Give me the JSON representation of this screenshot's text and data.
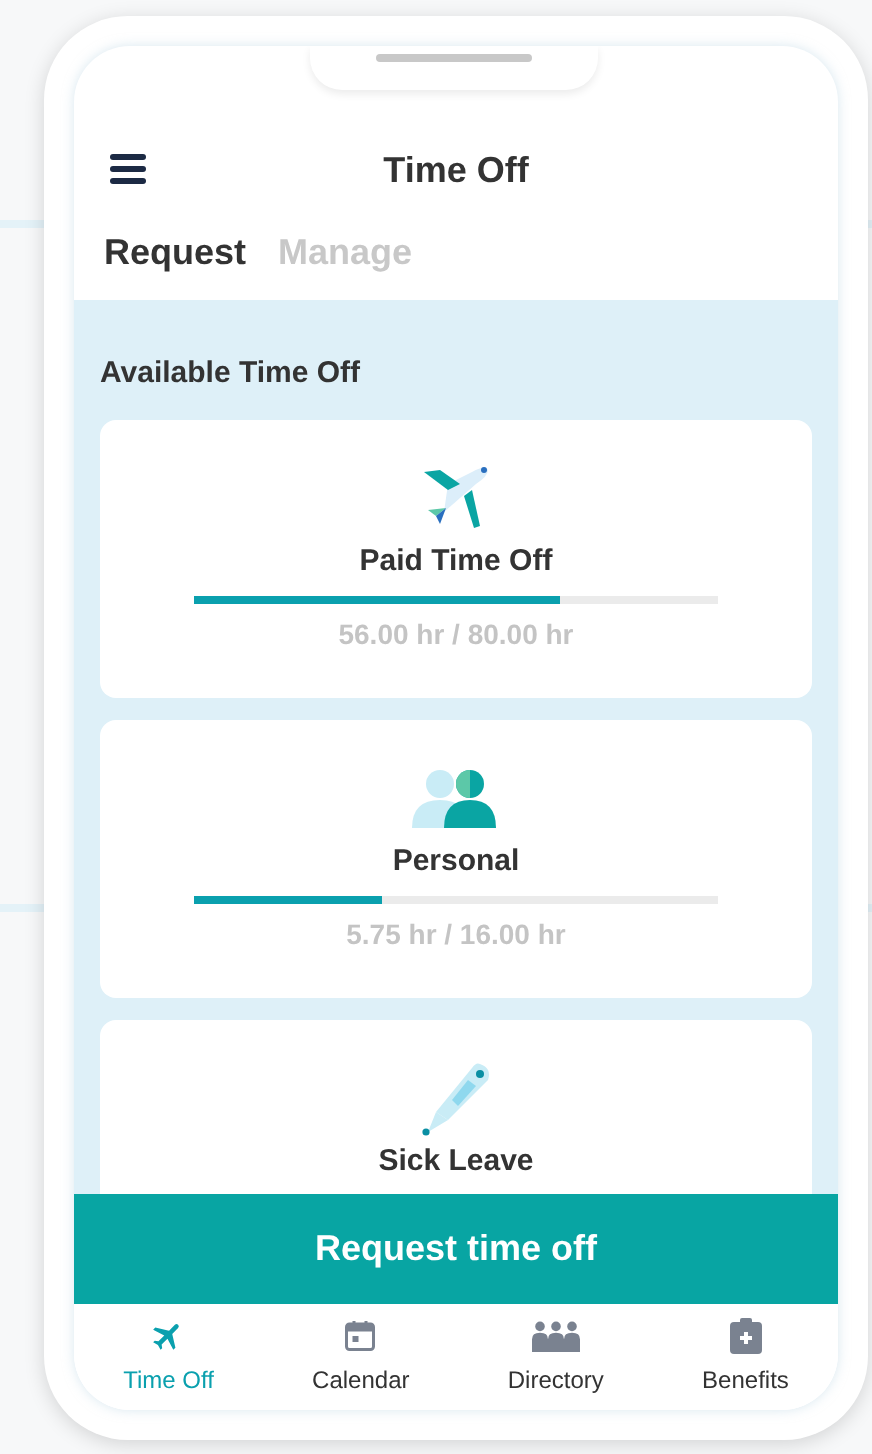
{
  "header": {
    "title": "Time Off"
  },
  "tabs": [
    {
      "label": "Request",
      "selected": true
    },
    {
      "label": "Manage",
      "selected": false
    }
  ],
  "section_title": "Available Time Off",
  "balances": [
    {
      "kind": "plane",
      "name": "Paid Time Off",
      "level": 0.7,
      "reading": "56.00 hr / 80.00 hr"
    },
    {
      "kind": "people",
      "name": "Personal",
      "level": 0.36,
      "reading": "5.75 hr / 16.00 hr"
    },
    {
      "kind": "thermometer",
      "name": "Sick Leave"
    }
  ],
  "primary_button": "Request time off",
  "nav": [
    {
      "kind": "plane",
      "label": "Time Off",
      "selected": true
    },
    {
      "kind": "calendar",
      "label": "Calendar",
      "selected": false
    },
    {
      "kind": "people",
      "label": "Directory",
      "selected": false
    },
    {
      "kind": "clipboard",
      "label": "Benefits",
      "selected": false
    }
  ]
}
